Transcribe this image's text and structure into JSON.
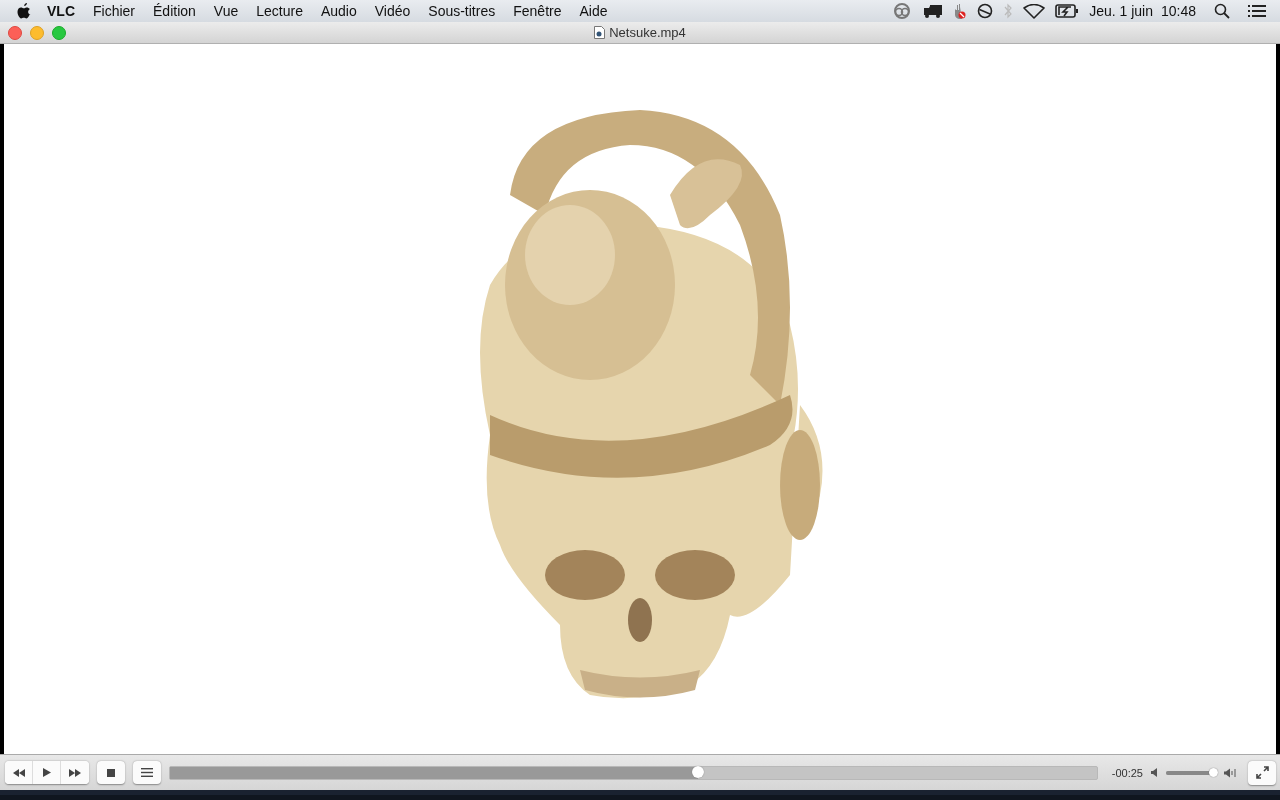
{
  "menubar": {
    "menus": [
      {
        "label": "VLC",
        "kind": "app"
      },
      {
        "label": "Fichier",
        "kind": "menu"
      },
      {
        "label": "Édition",
        "kind": "menu"
      },
      {
        "label": "Vue",
        "kind": "menu"
      },
      {
        "label": "Lecture",
        "kind": "menu"
      },
      {
        "label": "Audio",
        "kind": "menu"
      },
      {
        "label": "Vidéo",
        "kind": "menu"
      },
      {
        "label": "Sous-titres",
        "kind": "menu"
      },
      {
        "label": "Fenêtre",
        "kind": "menu"
      },
      {
        "label": "Aide",
        "kind": "menu"
      }
    ],
    "date": "Jeu. 1 juin",
    "time": "10:48"
  },
  "window": {
    "title": "Netsuke.mp4"
  },
  "controls": {
    "progress": {
      "level": 0.57
    },
    "remaining": "-00:25",
    "volume": {
      "level": 0.95
    }
  }
}
